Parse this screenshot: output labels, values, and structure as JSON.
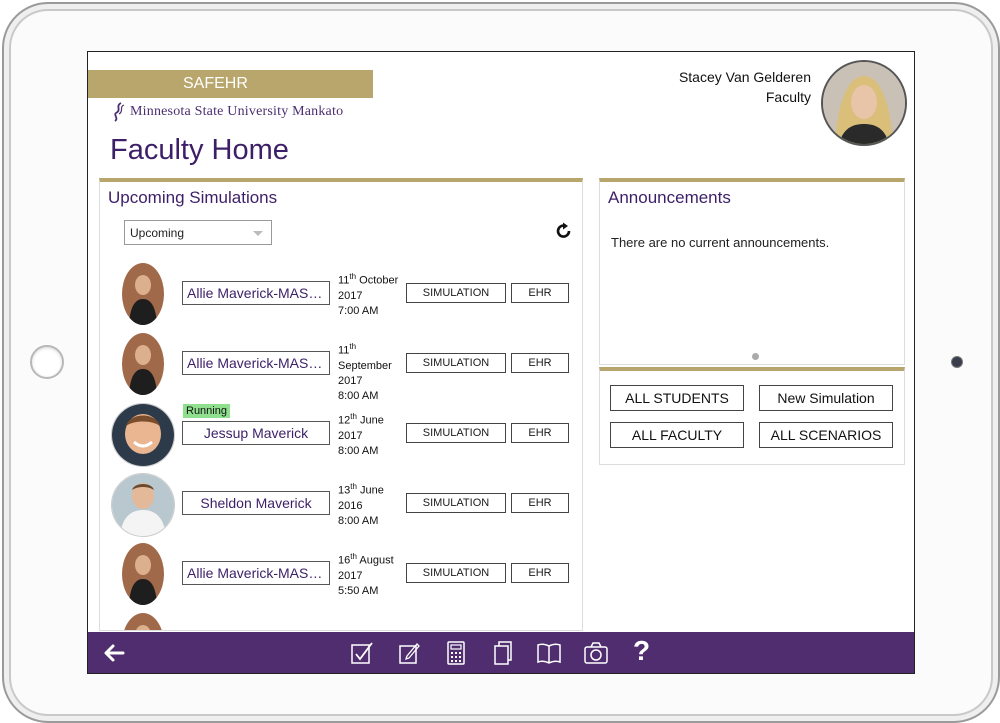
{
  "app": {
    "name": "SAFEHR",
    "university": "Minnesota State University Mankato",
    "page_title": "Faculty Home"
  },
  "user": {
    "name": "Stacey Van Gelderen",
    "role": "Faculty"
  },
  "simulations": {
    "title": "Upcoming Simulations",
    "filter_selected": "Upcoming",
    "rows": [
      {
        "name": "Allie Maverick-MASTER",
        "day": "11",
        "suffix": "th",
        "date_rest": "October 2017",
        "time": "7:00 AM",
        "sim_label": "SIMULATION",
        "ehr_label": "EHR",
        "running": ""
      },
      {
        "name": "Allie Maverick-MASTER",
        "day": "11",
        "suffix": "th",
        "date_rest": "September 2017",
        "time": "8:00 AM",
        "sim_label": "SIMULATION",
        "ehr_label": "EHR",
        "running": ""
      },
      {
        "name": "Jessup Maverick",
        "day": "12",
        "suffix": "th",
        "date_rest": "June 2017",
        "time": "8:00 AM",
        "sim_label": "SIMULATION",
        "ehr_label": "EHR",
        "running": "Running"
      },
      {
        "name": "Sheldon Maverick",
        "day": "13",
        "suffix": "th",
        "date_rest": "June 2016",
        "time": "8:00 AM",
        "sim_label": "SIMULATION",
        "ehr_label": "EHR",
        "running": ""
      },
      {
        "name": "Allie Maverick-MASTER",
        "day": "16",
        "suffix": "th",
        "date_rest": "August 2017",
        "time": "5:50 AM",
        "sim_label": "SIMULATION",
        "ehr_label": "EHR",
        "running": ""
      }
    ]
  },
  "announcements": {
    "title": "Announcements",
    "text": "There are no current announcements."
  },
  "actions": {
    "all_students": "ALL STUDENTS",
    "new_simulation": "New Simulation",
    "all_faculty": "ALL FACULTY",
    "all_scenarios": "ALL SCENARIOS"
  },
  "footer": {
    "help": "?"
  },
  "colors": {
    "brand_gold": "#b8a66c",
    "brand_purple": "#4f2d6e",
    "running_green": "#8ee08e"
  },
  "icons": [
    "back-arrow-icon",
    "refresh-icon",
    "checklist-icon",
    "notes-icon",
    "calculator-icon",
    "documents-icon",
    "book-icon",
    "camera-icon",
    "help-icon"
  ]
}
